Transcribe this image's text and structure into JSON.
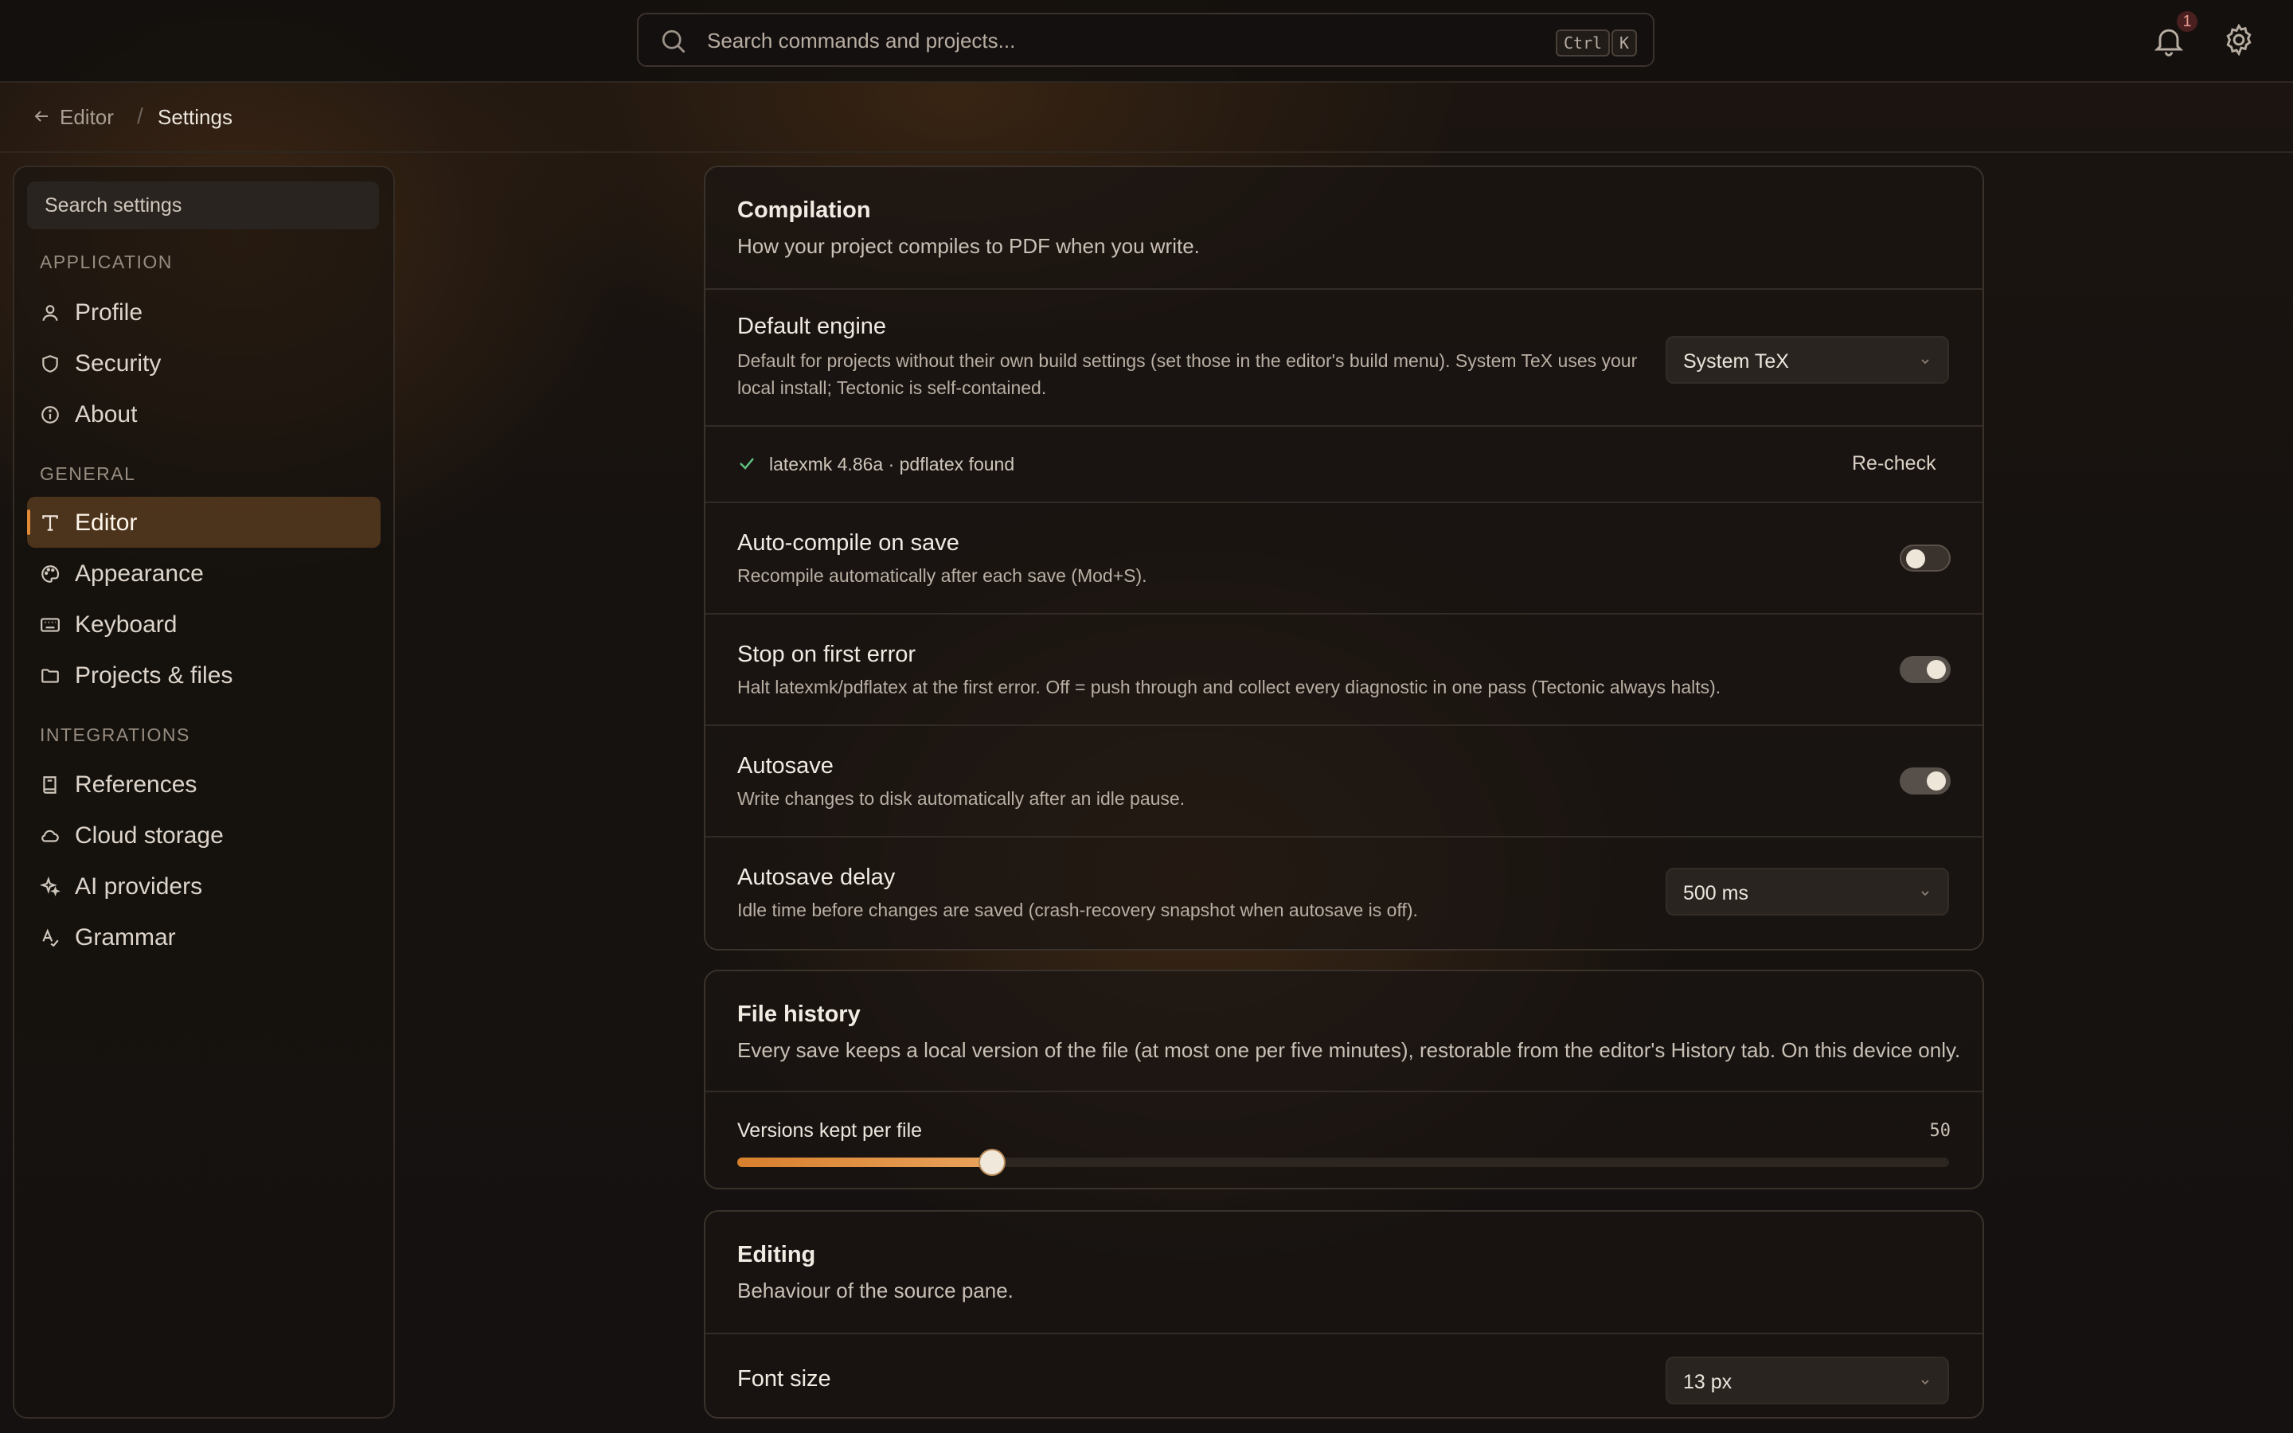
{
  "topbar": {
    "search_placeholder": "Search commands and projects...",
    "shortcut_keys": [
      "Ctrl",
      "K"
    ],
    "notification_count": "1"
  },
  "breadcrumb": {
    "parent": "Editor",
    "separator": "/",
    "current": "Settings"
  },
  "sidebar": {
    "search_placeholder": "Search settings",
    "sections": [
      {
        "title": "APPLICATION",
        "items": [
          {
            "label": "Profile",
            "icon": "user-icon"
          },
          {
            "label": "Security",
            "icon": "shield-icon"
          },
          {
            "label": "About",
            "icon": "info-icon"
          }
        ]
      },
      {
        "title": "GENERAL",
        "items": [
          {
            "label": "Editor",
            "icon": "text-icon",
            "active": true
          },
          {
            "label": "Appearance",
            "icon": "palette-icon"
          },
          {
            "label": "Keyboard",
            "icon": "keyboard-icon"
          },
          {
            "label": "Projects & files",
            "icon": "folder-icon"
          }
        ]
      },
      {
        "title": "INTEGRATIONS",
        "items": [
          {
            "label": "References",
            "icon": "book-icon"
          },
          {
            "label": "Cloud storage",
            "icon": "cloud-icon"
          },
          {
            "label": "AI providers",
            "icon": "sparkles-icon"
          },
          {
            "label": "Grammar",
            "icon": "spellcheck-icon"
          }
        ]
      }
    ]
  },
  "compilation": {
    "title": "Compilation",
    "description": "How your project compiles to PDF when you write.",
    "default_engine": {
      "label": "Default engine",
      "description_line1": "Default for projects without their own build settings (set those in the editor's build menu). System TeX uses your",
      "description_line2": "local install; Tectonic is self-contained.",
      "value": "System TeX"
    },
    "status": {
      "text": "latexmk 4.86a · pdflatex found",
      "action": "Re-check"
    },
    "auto_compile": {
      "label": "Auto-compile on save",
      "description": "Recompile automatically after each save (Mod+S).",
      "enabled": false
    },
    "stop_on_error": {
      "label": "Stop on first error",
      "description": "Halt latexmk/pdflatex at the first error. Off = push through and collect every diagnostic in one pass (Tectonic always halts).",
      "enabled": true
    },
    "autosave": {
      "label": "Autosave",
      "description": "Write changes to disk automatically after an idle pause.",
      "enabled": true
    },
    "autosave_delay": {
      "label": "Autosave delay",
      "description": "Idle time before changes are saved (crash-recovery snapshot when autosave is off).",
      "value": "500 ms"
    }
  },
  "file_history": {
    "title": "File history",
    "description": "Every save keeps a local version of the file (at most one per five minutes), restorable from the editor's History tab. On this device only.",
    "versions": {
      "label": "Versions kept per file",
      "value": "50",
      "fraction": 0.21
    }
  },
  "editing": {
    "title": "Editing",
    "description": "Behaviour of the source pane.",
    "font_size": {
      "label": "Font size",
      "value": "13 px"
    }
  },
  "colors": {
    "accent": "#e08a38",
    "background": "#16120f",
    "card": "#1a1512"
  }
}
